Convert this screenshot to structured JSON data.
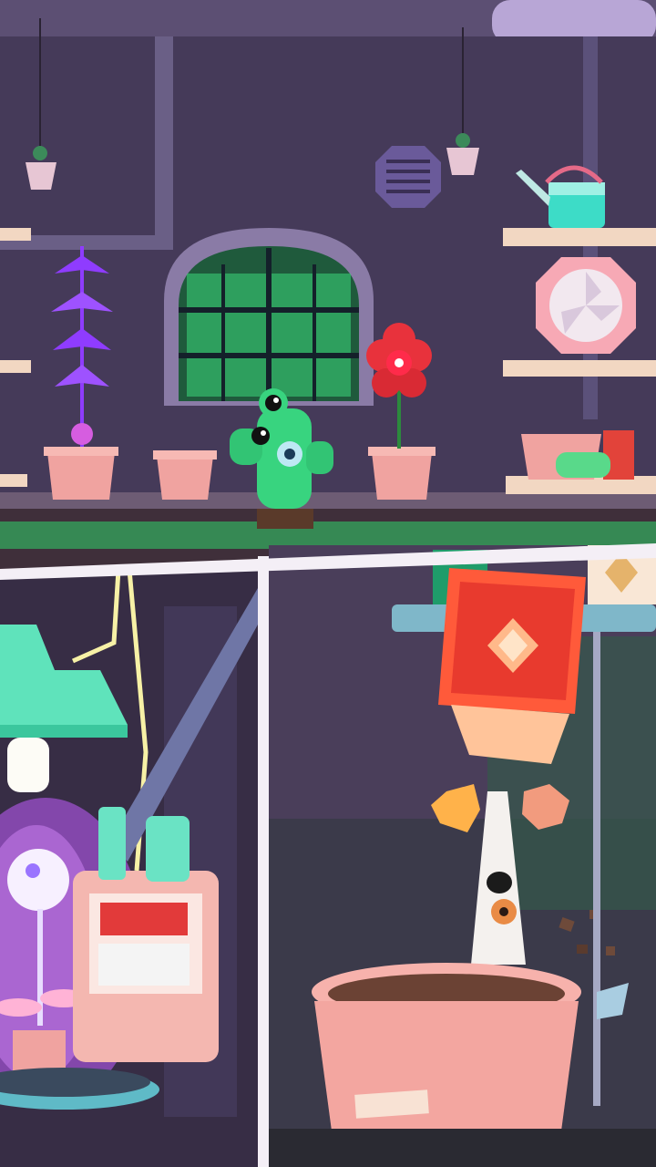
{
  "scene": {
    "top": {
      "description_name": "greenhouse-lab",
      "wall_color": "#4a3d5e",
      "window_glow": "#3bd97a",
      "shelf_color": "#f2d7c2",
      "pot_color": "#f0a3a0"
    },
    "bottom_left": {
      "description_name": "grow-lamp-station",
      "lamp_color": "#5fe3bb",
      "glow_color": "#c25cff"
    },
    "bottom_right": {
      "description_name": "seed-packet-pour",
      "packet_color": "#ff5a3a",
      "pot_color": "#f3a6a0"
    }
  },
  "icons": [
    "hanging-plant-icon",
    "vent-icon",
    "arched-window-icon",
    "cactus-monster-icon",
    "red-flower-monster-icon",
    "purple-fern-icon",
    "watering-can-icon",
    "fan-icon",
    "grow-lamp-icon",
    "glowing-sprout-icon",
    "seed-packet-icon",
    "root-creature-icon"
  ]
}
